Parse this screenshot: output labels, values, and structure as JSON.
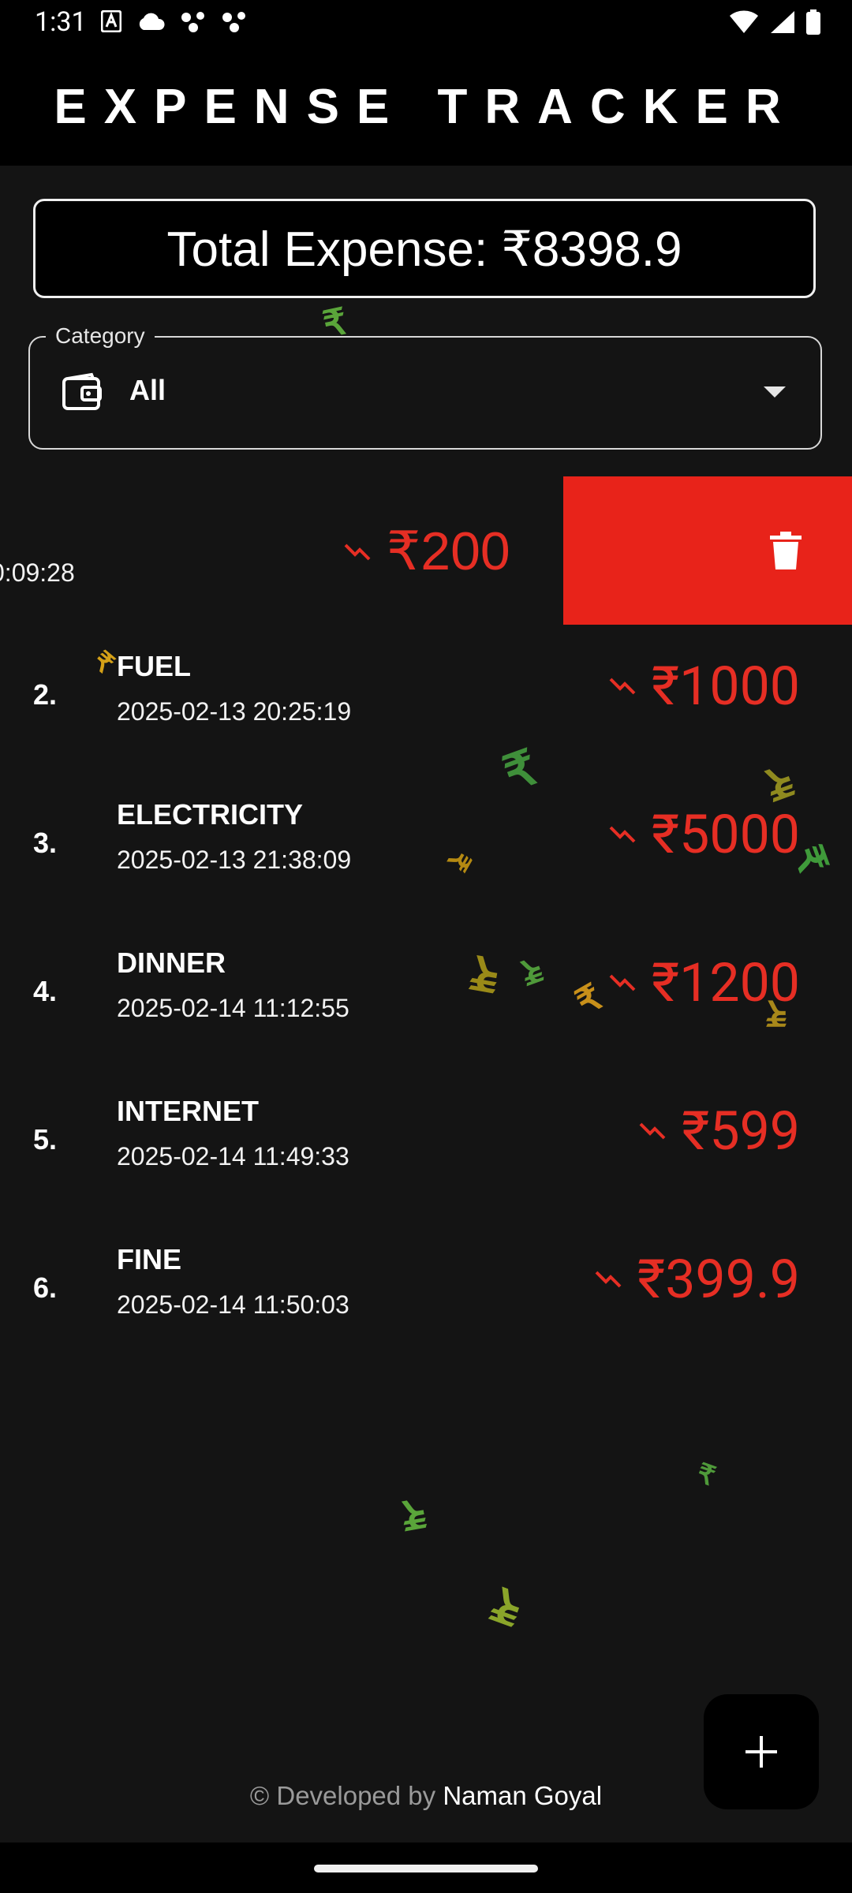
{
  "status_bar": {
    "time": "1:31",
    "left_icons": [
      "autofill-icon",
      "cloud-icon",
      "dots-icon",
      "dots-icon"
    ],
    "right_icons": [
      "wifi-icon",
      "signal-icon",
      "battery-icon"
    ]
  },
  "app": {
    "title": "EXPENSE TRACKER"
  },
  "total": {
    "text": "Total Expense: ₹8398.9"
  },
  "category": {
    "label": "Category",
    "value": "All"
  },
  "swiped_item": {
    "date_fragment": "0:09:28",
    "amount": "₹200"
  },
  "expenses": [
    {
      "index": "2.",
      "name": "FUEL",
      "date": "2025-02-13 20:25:19",
      "amount": "₹1000"
    },
    {
      "index": "3.",
      "name": "ELECTRICITY",
      "date": "2025-02-13 21:38:09",
      "amount": "₹5000"
    },
    {
      "index": "4.",
      "name": "DINNER",
      "date": "2025-02-14 11:12:55",
      "amount": "₹1200"
    },
    {
      "index": "5.",
      "name": "INTERNET",
      "date": "2025-02-14 11:49:33",
      "amount": "₹599"
    },
    {
      "index": "6.",
      "name": "FINE",
      "date": "2025-02-14 11:50:03",
      "amount": "₹399.9"
    }
  ],
  "footer": {
    "prefix": "© Developed by",
    "author": "Naman Goyal"
  },
  "colors": {
    "accent_red": "#e62e24",
    "delete_red": "#e8231a",
    "background": "#141414"
  },
  "decorations": {
    "glyph": "₹"
  }
}
